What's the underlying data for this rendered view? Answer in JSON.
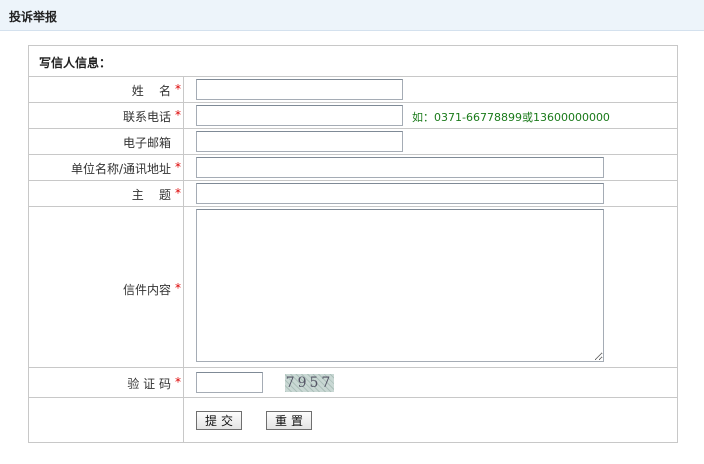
{
  "header": {
    "title": "投诉举报"
  },
  "form": {
    "section_title": "写信人信息：",
    "required_mark": "*",
    "fields": {
      "name": {
        "label": "姓    名",
        "value": ""
      },
      "phone": {
        "label": "联系电话",
        "value": "",
        "hint": "如：0371-66778899或13600000000"
      },
      "email": {
        "label": "电子邮箱",
        "value": ""
      },
      "address": {
        "label": "单位名称/通讯地址",
        "value": ""
      },
      "subject": {
        "label": "主    题",
        "value": ""
      },
      "content": {
        "label": "信件内容",
        "value": ""
      },
      "captcha": {
        "label": "验 证 码",
        "value": "",
        "image_text": "7957"
      }
    },
    "buttons": {
      "submit": "提交",
      "reset": "重置"
    }
  }
}
